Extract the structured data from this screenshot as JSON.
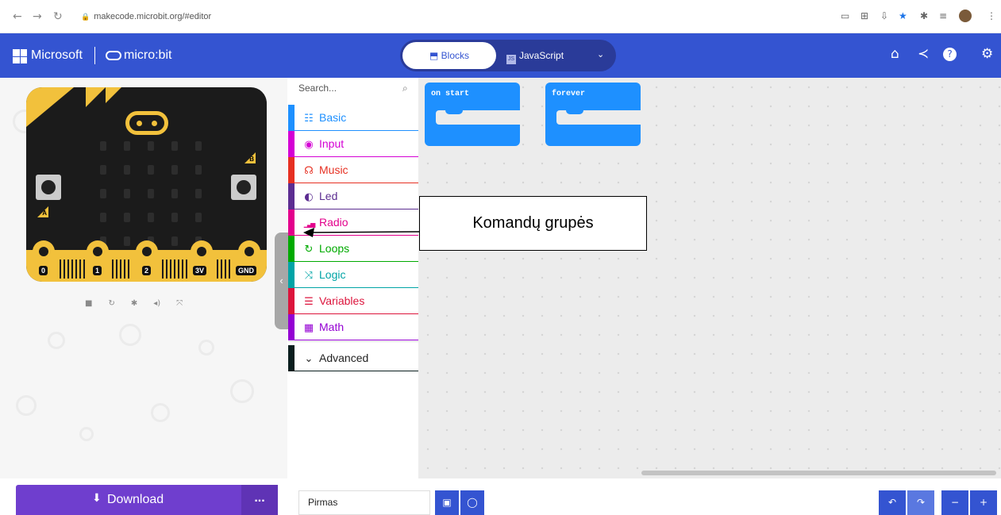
{
  "browser": {
    "url": "makecode.microbit.org/#editor"
  },
  "header": {
    "brand": "Microsoft",
    "product": "micro:bit",
    "tabs": [
      {
        "label": "Blocks",
        "active": true
      },
      {
        "label": "JavaScript",
        "active": false
      }
    ],
    "icons": [
      "home-icon",
      "share-icon",
      "help-icon",
      "settings-icon"
    ]
  },
  "simulator": {
    "button_a": "A",
    "button_b": "B",
    "pins": [
      "0",
      "1",
      "2",
      "3V",
      "GND"
    ],
    "controls": [
      "stop-icon",
      "restart-icon",
      "debug-icon",
      "mute-icon",
      "fullscreen-icon"
    ]
  },
  "toolbox": {
    "search_placeholder": "Search...",
    "categories": [
      {
        "label": "Basic",
        "color": "#1e90ff",
        "icon": "grid-icon"
      },
      {
        "label": "Input",
        "color": "#d400d4",
        "icon": "target-icon"
      },
      {
        "label": "Music",
        "color": "#e63022",
        "icon": "headphones-icon"
      },
      {
        "label": "Led",
        "color": "#5c2d91",
        "icon": "toggle-icon"
      },
      {
        "label": "Radio",
        "color": "#e3008c",
        "icon": "signal-icon"
      },
      {
        "label": "Loops",
        "color": "#00aa00",
        "icon": "loop-icon"
      },
      {
        "label": "Logic",
        "color": "#00a4a6",
        "icon": "shuffle-icon"
      },
      {
        "label": "Variables",
        "color": "#dc143c",
        "icon": "list-icon"
      },
      {
        "label": "Math",
        "color": "#9400d3",
        "icon": "calculator-icon"
      }
    ],
    "advanced": {
      "label": "Advanced",
      "color": "#0a1e1e"
    }
  },
  "workspace": {
    "blocks": [
      {
        "label": "on start"
      },
      {
        "label": "forever"
      }
    ]
  },
  "annotation": {
    "text": "Komandų grupės"
  },
  "footer": {
    "download_label": "Download",
    "more_label": "...",
    "project_name": "Pirmas"
  },
  "colors": {
    "header": "#3454d1",
    "download": "#6f3ece",
    "block": "#1e90ff"
  }
}
